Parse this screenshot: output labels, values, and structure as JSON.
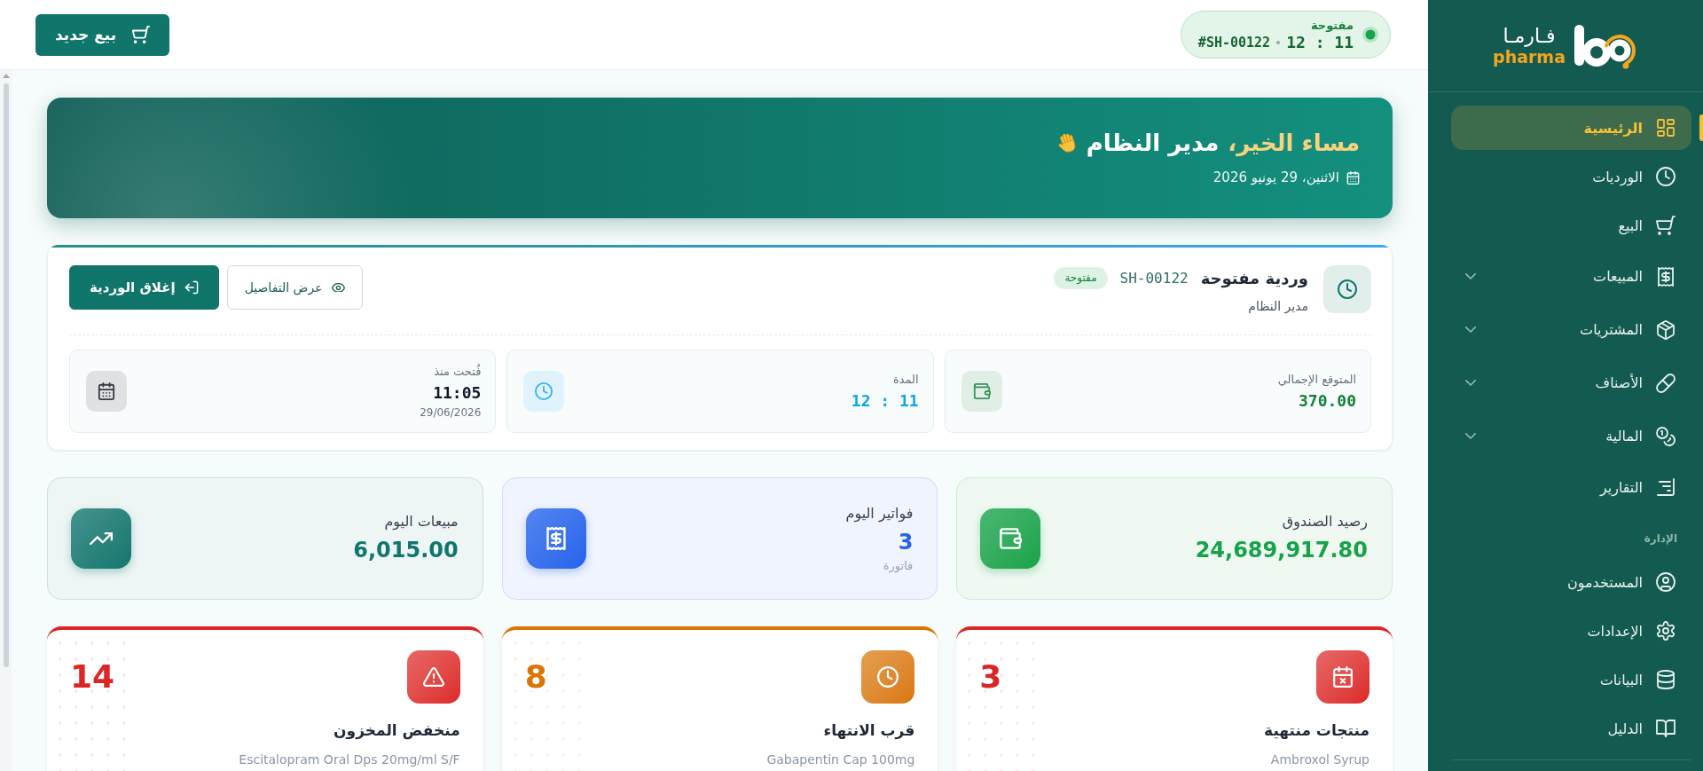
{
  "sidebar": {
    "logo": {
      "arabic": "فـارمـا",
      "latin": "pharma"
    },
    "items": [
      {
        "label": "الرئيسية",
        "kind": "link",
        "selected": true
      },
      {
        "label": "الورديات",
        "kind": "link",
        "selected": false
      },
      {
        "label": "البيع",
        "kind": "link",
        "selected": false
      },
      {
        "label": "المبيعات",
        "kind": "group",
        "selected": false
      },
      {
        "label": "المشتريات",
        "kind": "group",
        "selected": false
      },
      {
        "label": "الأصناف",
        "kind": "group",
        "selected": false
      },
      {
        "label": "المالية",
        "kind": "group",
        "selected": false
      },
      {
        "label": "التقارير",
        "kind": "link",
        "selected": false
      }
    ],
    "sections": [
      {
        "title": "الإدارة",
        "items": [
          {
            "label": "المستخدمون",
            "kind": "link",
            "selected": false
          },
          {
            "label": "الإعدادات",
            "kind": "link",
            "selected": false
          },
          {
            "label": "البيانات",
            "kind": "link",
            "selected": false
          },
          {
            "label": "الدليل",
            "kind": "link",
            "selected": false
          }
        ]
      }
    ]
  },
  "topbar": {
    "shift_pill": {
      "status": "مفتوحة",
      "shift_id": "#SH-00122",
      "elapsed": "12 : 11"
    },
    "new_sale_button": {
      "label": "بيع جديد"
    }
  },
  "banner": {
    "greeting": "مساء الخير،",
    "user_name": "مدير النظام",
    "date": "الاثنين، 29 يونيو 2026"
  },
  "shift": {
    "title": "وردية مفتوحة",
    "code": "SH-00122",
    "status": "مفتوحة",
    "user": "مدير النظام",
    "buttons": [
      {
        "label": "عرض التفاصيل",
        "kind": "outline"
      },
      {
        "label": "إغلاق الوردية",
        "kind": "primary"
      }
    ],
    "metrics": [
      {
        "label": "المتوقع الإجمالي",
        "value": "370.00",
        "color": "#15803d"
      },
      {
        "label": "المدة",
        "value": "12 : 11",
        "color": "#0ea5e9"
      },
      {
        "label": "فُتحت منذ",
        "value": "11:05",
        "sub": "29/06/2026",
        "color": "#111827"
      }
    ]
  },
  "stats": [
    {
      "label": "رصيد الصندوق",
      "value": "24,689,917.80",
      "color": "#16a34a"
    },
    {
      "label": "فواتير اليوم",
      "value": "3",
      "unit": "فاتورة",
      "color": "#2563eb"
    },
    {
      "label": "مبيعات اليوم",
      "value": "6,015.00",
      "color": "#0f766e"
    }
  ],
  "alerts": [
    {
      "title": "منتجات منتهية",
      "count": "3",
      "color": "#dc2626",
      "items": [
        "Ambroxol Syrup"
      ]
    },
    {
      "title": "قرب الانتهاء",
      "count": "8",
      "color": "#d97706",
      "items": [
        "Gabapentin Cap 100mg"
      ]
    },
    {
      "title": "منخفض المخزون",
      "count": "14",
      "color": "#dc2626",
      "items": [
        "Escitalopram Oral Dps 20mg/ml S/F"
      ]
    }
  ]
}
